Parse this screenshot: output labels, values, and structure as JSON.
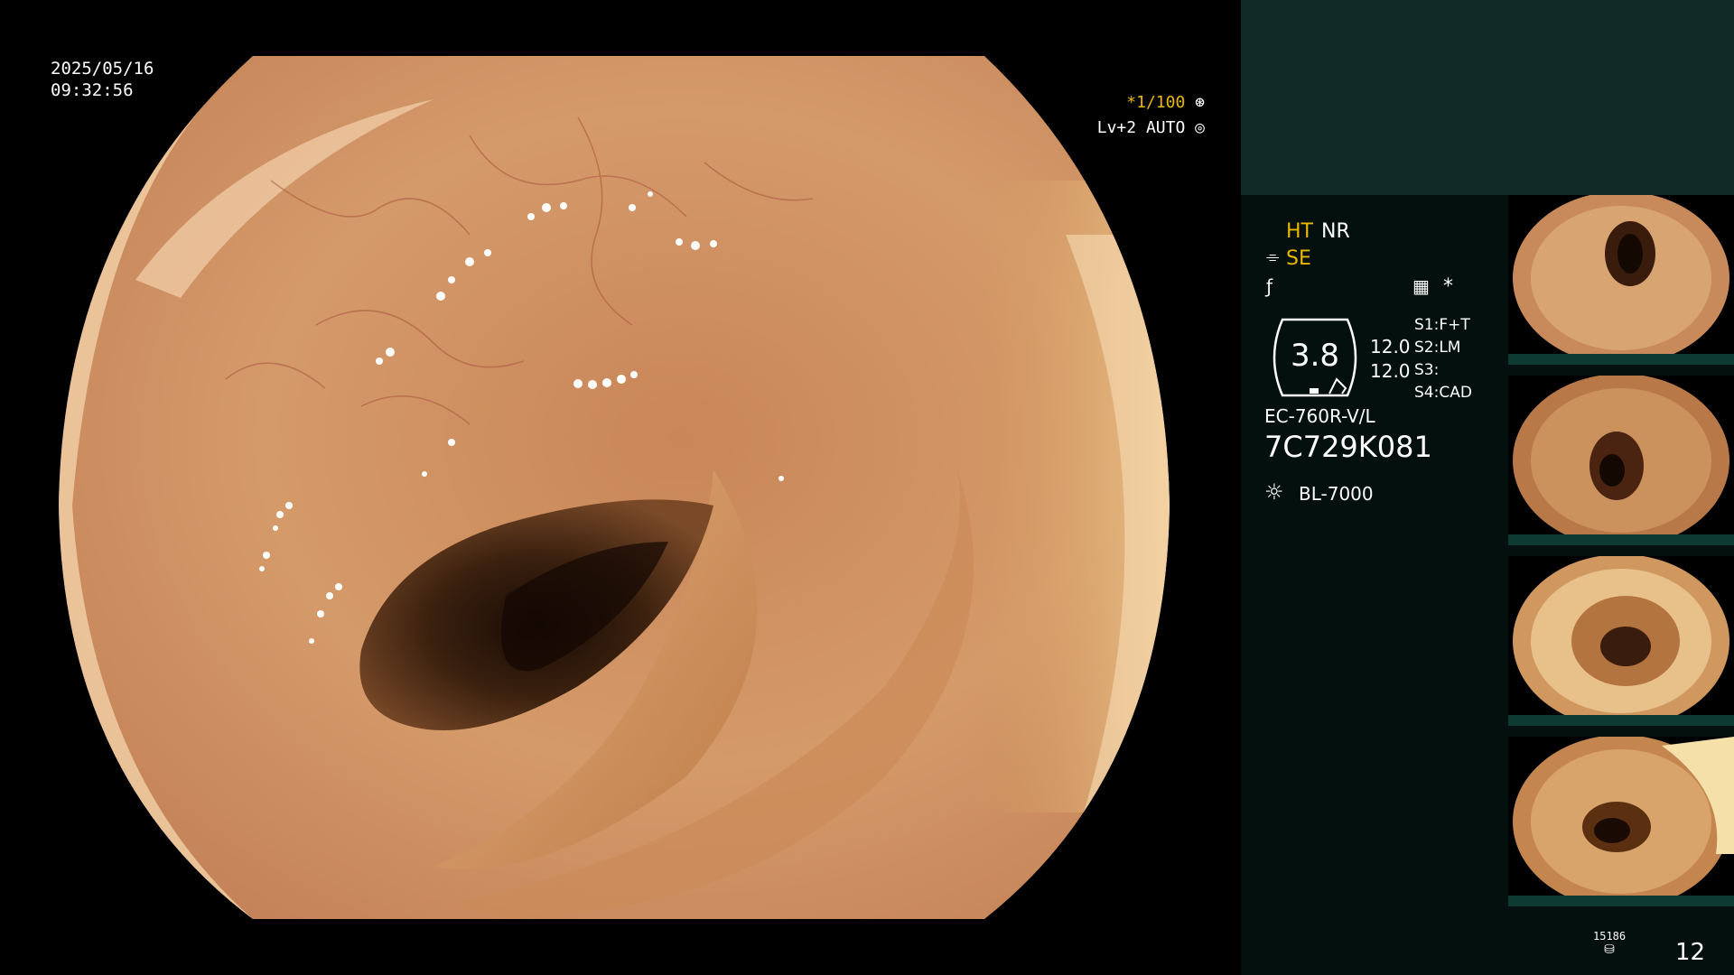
{
  "overlay": {
    "date": "2025/05/16",
    "time": "09:32:56",
    "shutter": "*1/100",
    "level": "Lv+2",
    "mode": "AUTO"
  },
  "panel": {
    "ht": "HT",
    "nr": "NR",
    "se": "SE",
    "asterisk": "*",
    "gauge_value": "3.8",
    "val1": "12.0",
    "val2": "12.0",
    "switches": [
      "S1:F+T",
      "S2:LM",
      "S3:",
      "S4:CAD"
    ],
    "scope_model": "EC-760R-V/L",
    "serial": "7C729K081",
    "light_source": "BL-7000",
    "storage_count": "15186",
    "image_count": "12"
  },
  "colors": {
    "panel_top": "#0f2a26",
    "panel": "#04100e",
    "accent_yellow": "#e8b800",
    "thumb_bar": "#0d3b33"
  },
  "icons": [
    "shutter-settings-icon",
    "auto-iris-icon",
    "structure-enhance-icon",
    "color-icon",
    "menu-grid-icon",
    "light-source-icon",
    "storage-icon"
  ]
}
